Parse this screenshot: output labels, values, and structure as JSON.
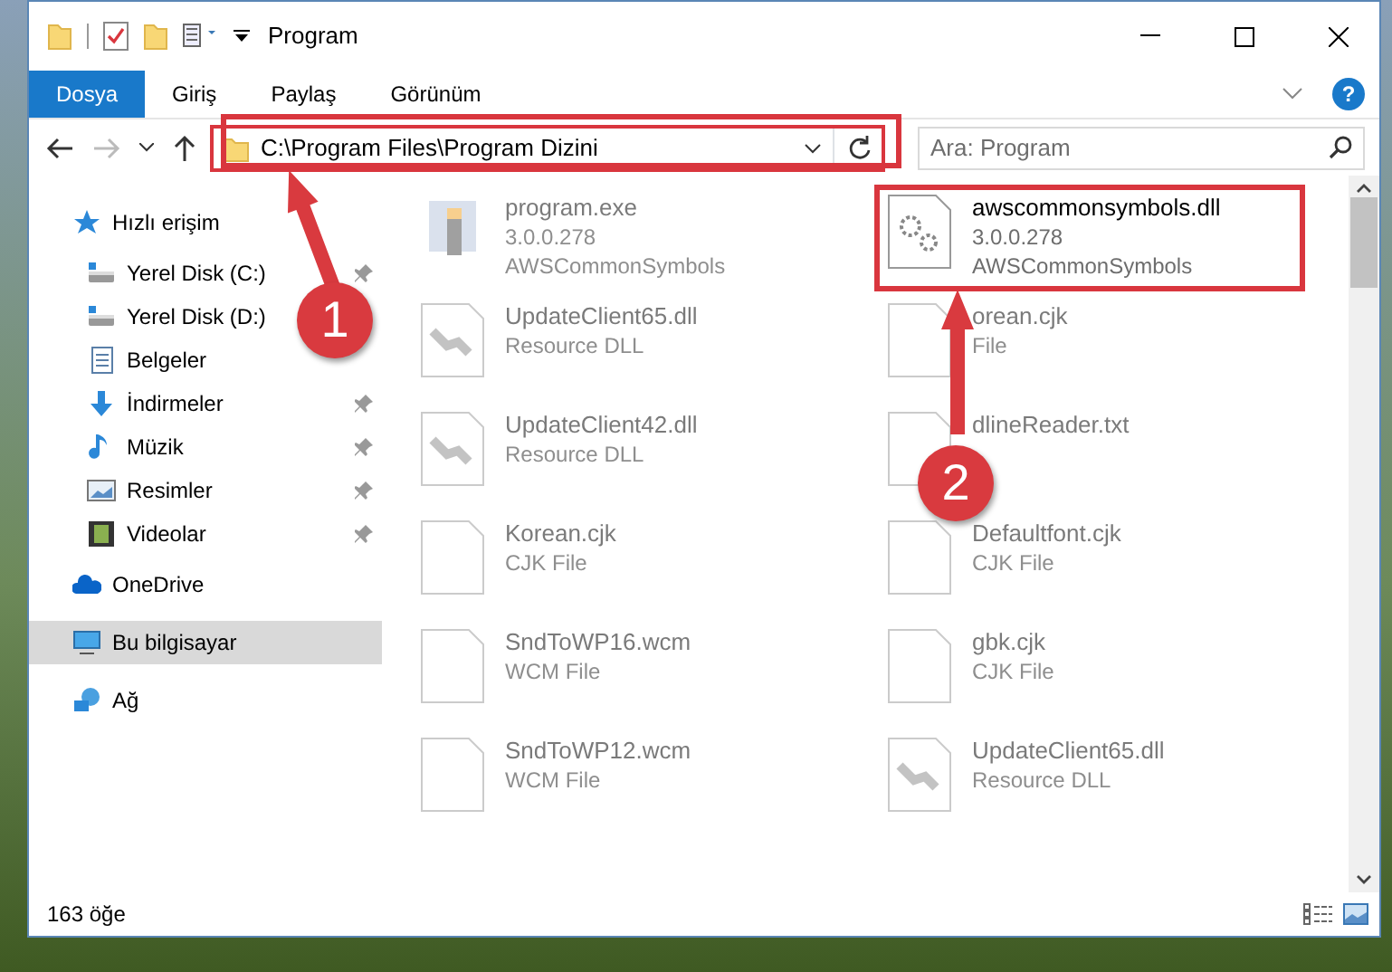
{
  "window": {
    "title": "Program"
  },
  "ribbon_tabs": [
    {
      "label": "Dosya",
      "kind": "file",
      "selected": false
    },
    {
      "label": "Giriş",
      "kind": "tab",
      "selected": false
    },
    {
      "label": "Paylaş",
      "kind": "tab",
      "selected": false
    },
    {
      "label": "Görünüm",
      "kind": "tab",
      "selected": false
    }
  ],
  "help_label": "?",
  "address_bar": {
    "path": "C:\\Program Files\\Program Dizini"
  },
  "search": {
    "placeholder": "Ara: Program"
  },
  "sidebar": {
    "items": [
      {
        "label": "Hızlı erişim",
        "kind": "star",
        "pinned": false,
        "selected": false,
        "children": [
          {
            "label": "Yerel Disk (C:)",
            "kind": "drive",
            "pinned": true,
            "selected": false
          },
          {
            "label": "Yerel Disk (D:)",
            "kind": "drive",
            "pinned": false,
            "selected": false
          },
          {
            "label": "Belgeler",
            "kind": "docs",
            "pinned": false,
            "selected": false
          },
          {
            "label": "İndirmeler",
            "kind": "download",
            "pinned": true,
            "selected": false
          },
          {
            "label": "Müzik",
            "kind": "music",
            "pinned": true,
            "selected": false
          },
          {
            "label": "Resimler",
            "kind": "pictures",
            "pinned": true,
            "selected": false
          },
          {
            "label": "Videolar",
            "kind": "videos",
            "pinned": true,
            "selected": false
          }
        ]
      },
      {
        "label": "OneDrive",
        "kind": "cloud",
        "pinned": false,
        "selected": false
      },
      {
        "label": "Bu bilgisayar",
        "kind": "pc",
        "pinned": false,
        "selected": true
      },
      {
        "label": "Ağ",
        "kind": "network",
        "pinned": false,
        "selected": false
      }
    ]
  },
  "files": [
    {
      "name": "program.exe",
      "details": [
        "3.0.0.278",
        "AWSCommonSymbols"
      ],
      "kind": "exe",
      "faded": true
    },
    {
      "name": "awscommonsymbols.dll",
      "details": [
        "3.0.0.278",
        "AWSCommonSymbols"
      ],
      "kind": "gears",
      "faded": false
    },
    {
      "name": "UpdateClient65.dll",
      "details": [
        "Resource DLL"
      ],
      "kind": "dll",
      "faded": true
    },
    {
      "name": "orean.cjk",
      "details": [
        "File"
      ],
      "kind": "doc",
      "faded": true
    },
    {
      "name": "UpdateClient42.dll",
      "details": [
        "Resource DLL"
      ],
      "kind": "dll",
      "faded": true
    },
    {
      "name": "dlineReader.txt",
      "kind": "doc",
      "faded": true
    },
    {
      "name": "Korean.cjk",
      "details": [
        "CJK File"
      ],
      "kind": "doc",
      "faded": true
    },
    {
      "name": "Defaultfont.cjk",
      "details": [
        "CJK File"
      ],
      "kind": "doc",
      "faded": true
    },
    {
      "name": "SndToWP16.wcm",
      "details": [
        "WCM File"
      ],
      "kind": "doc",
      "faded": true
    },
    {
      "name": "gbk.cjk",
      "details": [
        "CJK File"
      ],
      "kind": "doc",
      "faded": true
    },
    {
      "name": "SndToWP12.wcm",
      "details": [
        "WCM File"
      ],
      "kind": "doc",
      "faded": true
    },
    {
      "name": "UpdateClient65.dll",
      "details": [
        "Resource DLL"
      ],
      "kind": "dll",
      "faded": true
    }
  ],
  "status_bar": {
    "count": "163 öğe"
  },
  "annotations": [
    {
      "number": "1"
    },
    {
      "number": "2"
    }
  ]
}
